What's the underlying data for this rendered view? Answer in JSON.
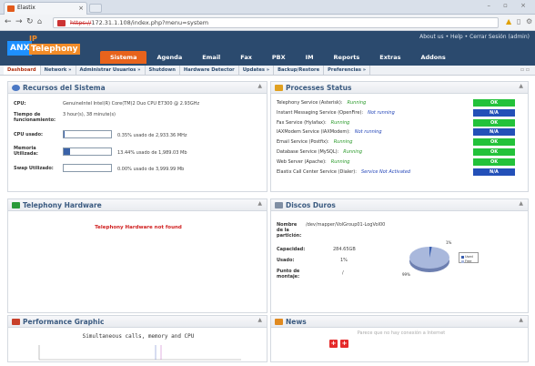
{
  "browser": {
    "tab_title": "Elastix",
    "tab_close": "×",
    "url_prefix": "https://",
    "url_rest": "172.31.1.108/index.php?menu=system",
    "window_controls": "– ▫ ×"
  },
  "header": {
    "logo_anx": "ANX",
    "logo_ip": "IP",
    "logo_telephony": "Telephony",
    "top_links": "About us  •  Help  •  Cerrar Sesión (admin)",
    "menu": [
      "Sistema",
      "Agenda",
      "Email",
      "Fax",
      "PBX",
      "IM",
      "Reports",
      "Extras",
      "Addons"
    ]
  },
  "submenu": {
    "items": [
      "Dashboard",
      "Network »",
      "Administrar Usuarios »",
      "Shutdown",
      "Hardware Detector",
      "Updates »",
      "Backup/Restore",
      "Preferencias »"
    ],
    "tools": "▫ ▫"
  },
  "resources": {
    "title": "Recursos del Sistema",
    "collapse": "▲",
    "cpu_label": "CPU:",
    "cpu_value": "GenuineIntel Intel(R) Core(TM)2 Duo CPU E7300 @ 2.93GHz",
    "uptime_label": "Tiempo de funcionamiento:",
    "uptime_value": "3 hour(s), 38 minute(s)",
    "cpu_usage_label": "CPU usado:",
    "cpu_usage_text": "0.35% usado de 2,933.36 MHz",
    "cpu_usage_pct": 0.35,
    "mem_label": "Memoria Utilizada:",
    "mem_text": "13.44% usado de 1,989.03 Mb",
    "mem_pct": 13.44,
    "swap_label": "Swap Utilizado:",
    "swap_text": "0.00% usado de 3,999.99 Mb",
    "swap_pct": 0.0
  },
  "processes": {
    "title": "Processes Status",
    "collapse": "▲",
    "services": [
      {
        "name": "Telephony Service (Asterisk):",
        "status": "Running",
        "badge": "OK"
      },
      {
        "name": "Instant Messaging Service (OpenFire):",
        "status": "Not running",
        "badge": "N/A"
      },
      {
        "name": "Fax Service (Hylafax):",
        "status": "Running",
        "badge": "OK"
      },
      {
        "name": "IAXModem Service (IAXModem):",
        "status": "Not running",
        "badge": "N/A"
      },
      {
        "name": "Email Service (Postfix):",
        "status": "Running",
        "badge": "OK"
      },
      {
        "name": "Database Service (MySQL):",
        "status": "Running",
        "badge": "OK"
      },
      {
        "name": "Web Server (Apache):",
        "status": "Running",
        "badge": "OK"
      },
      {
        "name": "Elastix Call Center Service (Dialer):",
        "status": "Service Not Activated",
        "badge": "N/A"
      }
    ]
  },
  "hardware": {
    "title": "Telephony Hardware",
    "collapse": "▲",
    "message": "Telephony Hardware not found"
  },
  "disks": {
    "title": "Discos Duros",
    "collapse": "▲",
    "partition_label": "Nombre de la partición:",
    "partition_value": "/dev/mapper/VolGroup01-LogVol00",
    "capacity_label": "Capacidad:",
    "capacity_value": "284.65GB",
    "used_label": "Usado:",
    "used_value": "1%",
    "mount_label": "Punto de montaje:",
    "mount_value": "/",
    "pie_used_label": "1%",
    "pie_free_label": "99%",
    "legend_used": "Used",
    "legend_free": "Free",
    "used_pct": 1
  },
  "performance": {
    "title": "Performance Graphic",
    "collapse": "▲",
    "chart_title": "Simultaneous calls, memory and CPU"
  },
  "news": {
    "title": "News",
    "collapse": "▲",
    "message": "Parece que no hay conexión a Internet"
  },
  "colors": {
    "header_bg": "#2b4a6e",
    "active_menu": "#e8631c",
    "ok_badge": "#23c23a",
    "na_badge": "#2350b8",
    "panel_title": "#3a5a80",
    "pie_used": "#3a5fb0",
    "pie_free": "#a9b8dc"
  }
}
